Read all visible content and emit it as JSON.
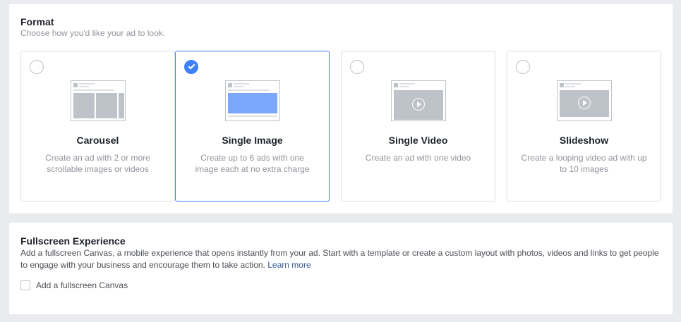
{
  "format": {
    "title": "Format",
    "subtitle": "Choose how you'd like your ad to look.",
    "options": [
      {
        "title": "Carousel",
        "description": "Create an ad with 2 or more scrollable images or videos",
        "selected": false,
        "icon": "carousel-thumbnail-icon"
      },
      {
        "title": "Single Image",
        "description": "Create up to 6 ads with one image each at no extra charge",
        "selected": true,
        "icon": "single-image-thumbnail-icon"
      },
      {
        "title": "Single Video",
        "description": "Create an ad with one video",
        "selected": false,
        "icon": "single-video-thumbnail-icon"
      },
      {
        "title": "Slideshow",
        "description": "Create a looping video ad with up to 10 images",
        "selected": false,
        "icon": "slideshow-thumbnail-icon"
      }
    ]
  },
  "fullscreen": {
    "title": "Fullscreen Experience",
    "description": "Add a fullscreen Canvas, a mobile experience that opens instantly from your ad. Start with a template or create a custom layout with photos, videos and links to get people to engage with your business and encourage them to take action.",
    "learn_more": "Learn more",
    "checkbox_label": "Add a fullscreen Canvas",
    "checkbox_checked": false
  },
  "colors": {
    "accent": "#4080ff",
    "link": "#365899",
    "background": "#e9ebee"
  }
}
